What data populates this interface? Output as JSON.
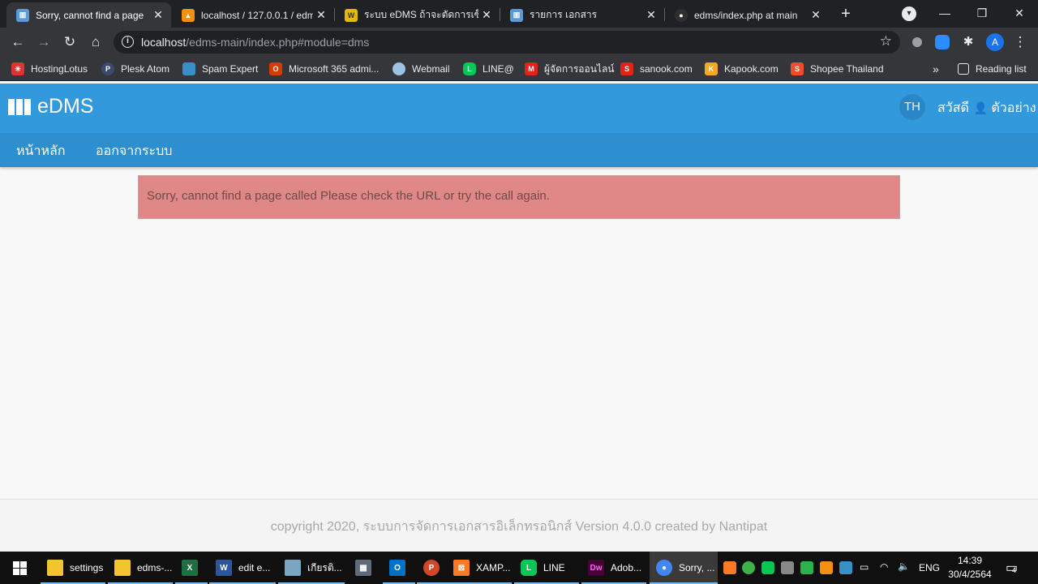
{
  "browser": {
    "tabs": [
      {
        "title": "Sorry, cannot find a page",
        "favicon_color": "#5b9bd5",
        "active": true
      },
      {
        "title": "localhost / 127.0.0.1 / edm",
        "favicon_color": "#f29111",
        "active": false
      },
      {
        "title": "ระบบ eDMS ถ้าจะตัดการเซ็ตไ",
        "favicon_color": "#e6b800",
        "active": false
      },
      {
        "title": "รายการ เอกสาร",
        "favicon_color": "#5b9bd5",
        "active": false
      },
      {
        "title": "edms/index.php at main",
        "favicon_color": "#303030",
        "active": false
      }
    ],
    "new_tab": "+",
    "url_host": "localhost",
    "url_path": "/edms-main/index.php#module=dms",
    "profile_initial": "A",
    "bookmarks": [
      {
        "label": "HostingLotus",
        "color": "#d33"
      },
      {
        "label": "Plesk Atom",
        "color": "#3b4a6b"
      },
      {
        "label": "Spam Expert",
        "color": "#3a8fc9"
      },
      {
        "label": "Microsoft 365 admi...",
        "color": "#d83b01"
      },
      {
        "label": "Webmail",
        "color": "#9cc3e6"
      },
      {
        "label": "LINE@",
        "color": "#06c755"
      },
      {
        "label": "ผู้จัดการออนไลน์",
        "color": "#e2231a"
      },
      {
        "label": "sanook.com",
        "color": "#e2231a"
      },
      {
        "label": "Kapook.com",
        "color": "#f5a623"
      },
      {
        "label": "Shopee Thailand",
        "color": "#ee4d2d"
      }
    ],
    "more_bookmarks": "»",
    "reading_list": "Reading list"
  },
  "app": {
    "brand": "eDMS",
    "language": "TH",
    "greeting": "สวัสดี",
    "user_name": "ตัวอย่าง",
    "nav": [
      {
        "label": "หน้าหลัก"
      },
      {
        "label": "ออกจากระบบ"
      }
    ],
    "error_message": "Sorry, cannot find a page called Please check the URL or try the call again.",
    "footer": "copyright 2020, ระบบการจัดการเอกสารอิเล็กทรอนิกส์ Version 4.0.0 created by Nantipat",
    "alert_color": "#e08888",
    "header_color": "#3399dd"
  },
  "taskbar": {
    "items": [
      {
        "label": "settings",
        "color": "#f4c430"
      },
      {
        "label": "edms-...",
        "color": "#f4c430"
      },
      {
        "label": "",
        "color": "#1d6f42"
      },
      {
        "label": "edit e...",
        "color": "#2b579a"
      },
      {
        "label": "เกียรติ...",
        "color": "#7aa6c2"
      },
      {
        "label": "",
        "color": "#5f6b7a"
      },
      {
        "label": "",
        "color": "#0072c6"
      },
      {
        "label": "",
        "color": "#d24726"
      },
      {
        "label": "XAMP...",
        "color": "#fb7a24"
      },
      {
        "label": "LINE",
        "color": "#06c755"
      },
      {
        "label": "Adob...",
        "color": "#470137"
      },
      {
        "label": "Sorry, ...",
        "color": "#4285f4"
      }
    ],
    "language": "ENG",
    "time": "14:39",
    "date": "30/4/2564",
    "notifications": "4"
  }
}
